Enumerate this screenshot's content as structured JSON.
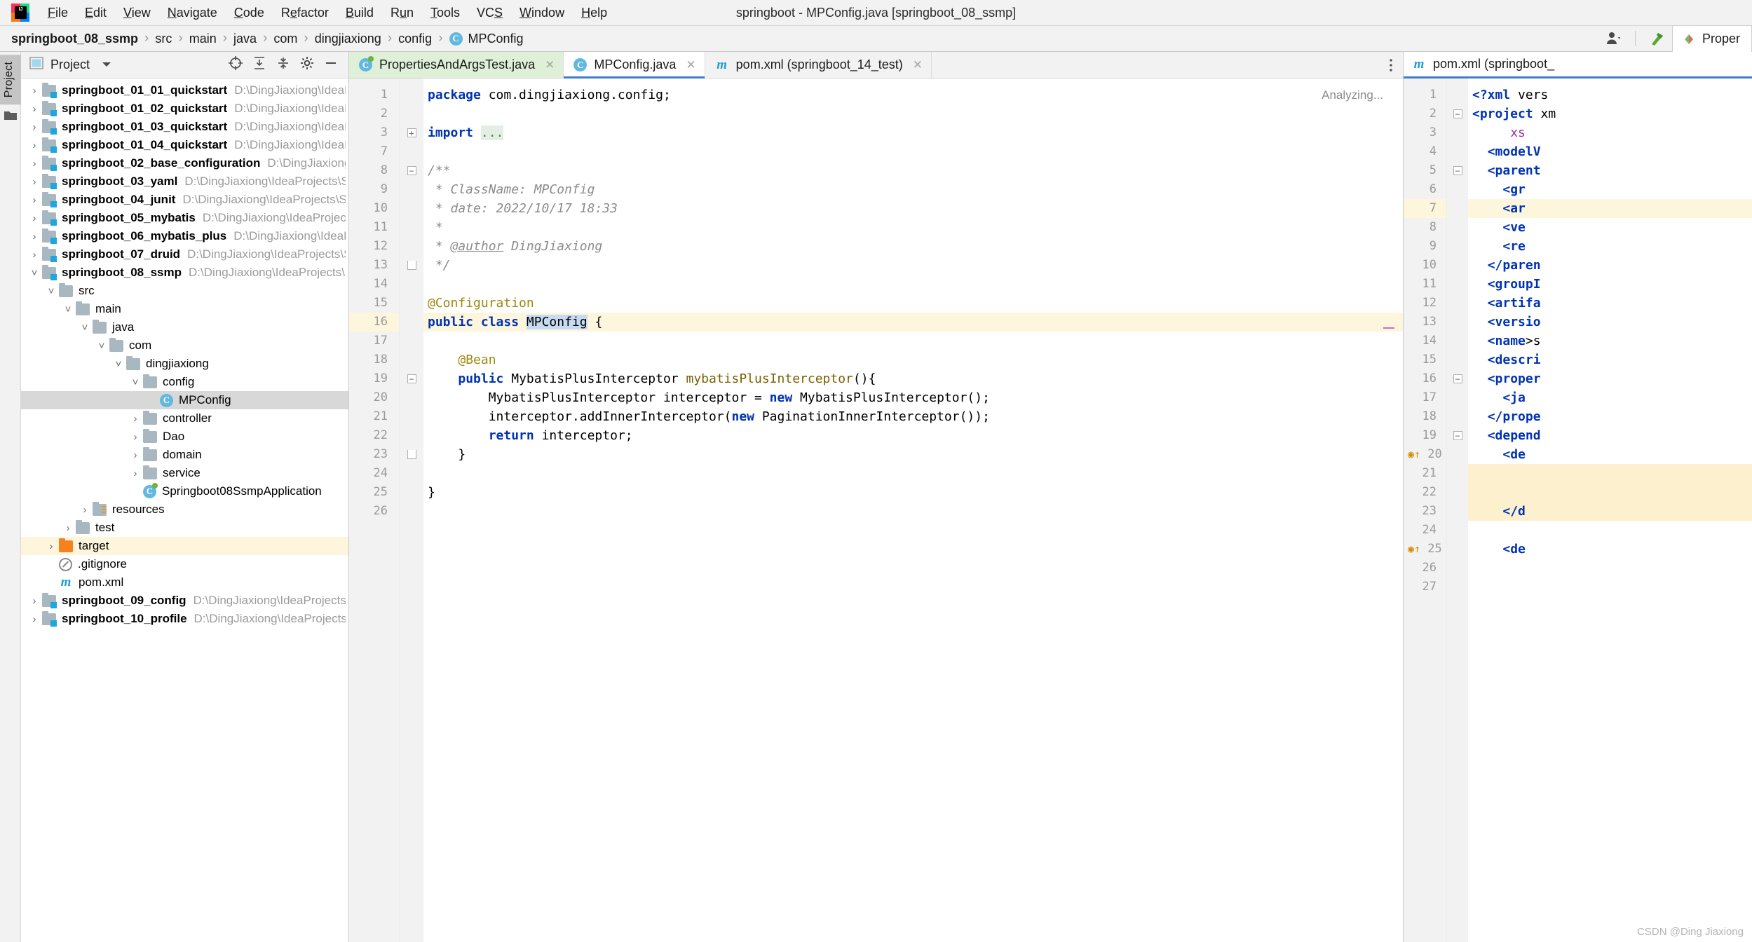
{
  "window": {
    "title": "springboot - MPConfig.java [springboot_08_ssmp]",
    "logo_text": "IJ"
  },
  "menubar": {
    "items": [
      {
        "label": "File",
        "mnemonic": "F"
      },
      {
        "label": "Edit",
        "mnemonic": "E"
      },
      {
        "label": "View",
        "mnemonic": "V"
      },
      {
        "label": "Navigate",
        "mnemonic": "N"
      },
      {
        "label": "Code",
        "mnemonic": "C"
      },
      {
        "label": "Refactor",
        "mnemonic": "e"
      },
      {
        "label": "Build",
        "mnemonic": "B"
      },
      {
        "label": "Run",
        "mnemonic": "u"
      },
      {
        "label": "Tools",
        "mnemonic": "T"
      },
      {
        "label": "VCS",
        "mnemonic": "S"
      },
      {
        "label": "Window",
        "mnemonic": "W"
      },
      {
        "label": "Help",
        "mnemonic": "H"
      }
    ]
  },
  "navbar": {
    "crumbs": [
      {
        "label": "springboot_08_ssmp",
        "bold": true,
        "icon": ""
      },
      {
        "label": "src",
        "bold": false,
        "icon": ""
      },
      {
        "label": "main",
        "bold": false,
        "icon": ""
      },
      {
        "label": "java",
        "bold": false,
        "icon": ""
      },
      {
        "label": "com",
        "bold": false,
        "icon": ""
      },
      {
        "label": "dingjiaxiong",
        "bold": false,
        "icon": ""
      },
      {
        "label": "config",
        "bold": false,
        "icon": ""
      },
      {
        "label": "MPConfig",
        "bold": false,
        "icon": "class-icon",
        "icon_letter": "C"
      }
    ],
    "separator": "›",
    "properties_tab_label": "Proper"
  },
  "tool_strip": {
    "project_tab_label": "Project"
  },
  "project_panel": {
    "header_title": "Project",
    "tree": [
      {
        "depth": 0,
        "arrow": "›",
        "icon": "module-folder-icon",
        "label": "springboot_01_01_quickstart",
        "path": "D:\\DingJiaxiong\\IdeaProje",
        "bold": true
      },
      {
        "depth": 0,
        "arrow": "›",
        "icon": "module-folder-icon",
        "label": "springboot_01_02_quickstart",
        "path": "D:\\DingJiaxiong\\IdeaProje",
        "bold": true
      },
      {
        "depth": 0,
        "arrow": "›",
        "icon": "module-folder-icon",
        "label": "springboot_01_03_quickstart",
        "path": "D:\\DingJiaxiong\\IdeaProje",
        "bold": true
      },
      {
        "depth": 0,
        "arrow": "›",
        "icon": "module-folder-icon",
        "label": "springboot_01_04_quickstart",
        "path": "D:\\DingJiaxiong\\IdeaProje",
        "bold": true
      },
      {
        "depth": 0,
        "arrow": "›",
        "icon": "module-folder-icon",
        "label": "springboot_02_base_configuration",
        "path": "D:\\DingJiaxiong\\Idea",
        "bold": true
      },
      {
        "depth": 0,
        "arrow": "›",
        "icon": "module-folder-icon",
        "label": "springboot_03_yaml",
        "path": "D:\\DingJiaxiong\\IdeaProjects\\Spring",
        "bold": true
      },
      {
        "depth": 0,
        "arrow": "›",
        "icon": "module-folder-icon",
        "label": "springboot_04_junit",
        "path": "D:\\DingJiaxiong\\IdeaProjects\\Sprin",
        "bold": true
      },
      {
        "depth": 0,
        "arrow": "›",
        "icon": "module-folder-icon",
        "label": "springboot_05_mybatis",
        "path": "D:\\DingJiaxiong\\IdeaProjects\\Sp",
        "bold": true
      },
      {
        "depth": 0,
        "arrow": "›",
        "icon": "module-folder-icon",
        "label": "springboot_06_mybatis_plus",
        "path": "D:\\DingJiaxiong\\IdeaProje",
        "bold": true
      },
      {
        "depth": 0,
        "arrow": "›",
        "icon": "module-folder-icon",
        "label": "springboot_07_druid",
        "path": "D:\\DingJiaxiong\\IdeaProjects\\Sprin",
        "bold": true
      },
      {
        "depth": 0,
        "arrow": "˅",
        "icon": "module-folder-icon",
        "label": "springboot_08_ssmp",
        "path": "D:\\DingJiaxiong\\IdeaProjects\\Sprin",
        "bold": true
      },
      {
        "depth": 1,
        "arrow": "˅",
        "icon": "folder-icon",
        "label": "src",
        "path": "",
        "bold": false
      },
      {
        "depth": 2,
        "arrow": "˅",
        "icon": "folder-icon",
        "label": "main",
        "path": "",
        "bold": false
      },
      {
        "depth": 3,
        "arrow": "˅",
        "icon": "folder-icon",
        "label": "java",
        "path": "",
        "bold": false
      },
      {
        "depth": 4,
        "arrow": "˅",
        "icon": "folder-icon",
        "label": "com",
        "path": "",
        "bold": false
      },
      {
        "depth": 5,
        "arrow": "˅",
        "icon": "folder-icon",
        "label": "dingjiaxiong",
        "path": "",
        "bold": false
      },
      {
        "depth": 6,
        "arrow": "˅",
        "icon": "folder-icon",
        "label": "config",
        "path": "",
        "bold": false
      },
      {
        "depth": 7,
        "arrow": "",
        "icon": "class-icon",
        "label": "MPConfig",
        "path": "",
        "bold": false,
        "selected": true
      },
      {
        "depth": 6,
        "arrow": "›",
        "icon": "folder-icon",
        "label": "controller",
        "path": "",
        "bold": false
      },
      {
        "depth": 6,
        "arrow": "›",
        "icon": "folder-icon",
        "label": "Dao",
        "path": "",
        "bold": false
      },
      {
        "depth": 6,
        "arrow": "›",
        "icon": "folder-icon",
        "label": "domain",
        "path": "",
        "bold": false
      },
      {
        "depth": 6,
        "arrow": "›",
        "icon": "folder-icon",
        "label": "service",
        "path": "",
        "bold": false
      },
      {
        "depth": 6,
        "arrow": "",
        "icon": "spring-class-icon",
        "label": "Springboot08SsmpApplication",
        "path": "",
        "bold": false
      },
      {
        "depth": 3,
        "arrow": "›",
        "icon": "resources-folder-icon",
        "label": "resources",
        "path": "",
        "bold": false
      },
      {
        "depth": 2,
        "arrow": "›",
        "icon": "folder-icon",
        "label": "test",
        "path": "",
        "bold": false
      },
      {
        "depth": 1,
        "arrow": "›",
        "icon": "target-folder-icon",
        "label": "target",
        "path": "",
        "bold": false,
        "highlight": true
      },
      {
        "depth": 1,
        "arrow": "",
        "icon": "gitignore-icon",
        "label": ".gitignore",
        "path": "",
        "bold": false
      },
      {
        "depth": 1,
        "arrow": "",
        "icon": "maven-icon",
        "label": "pom.xml",
        "path": "",
        "bold": false
      },
      {
        "depth": 0,
        "arrow": "›",
        "icon": "module-folder-icon",
        "label": "springboot_09_config",
        "path": "D:\\DingJiaxiong\\IdeaProjects\\Spri",
        "bold": true
      },
      {
        "depth": 0,
        "arrow": "›",
        "icon": "module-folder-icon",
        "label": "springboot_10_profile",
        "path": "D:\\DingJiaxiong\\IdeaProjects\\Sp",
        "bold": true
      }
    ]
  },
  "editor": {
    "tabs": [
      {
        "label": "PropertiesAndArgsTest.java",
        "icon": "test-class-icon",
        "state": "modified",
        "closable": true
      },
      {
        "label": "MPConfig.java",
        "icon": "class-icon",
        "state": "active",
        "closable": true
      },
      {
        "label": "pom.xml (springboot_14_test)",
        "icon": "maven-icon",
        "state": "normal",
        "closable": true
      }
    ],
    "status_text": "Analyzing...",
    "lines": [
      {
        "num": "1",
        "fold": "",
        "text": "package com.dingjiaxiong.config;"
      },
      {
        "num": "2",
        "fold": "",
        "text": ""
      },
      {
        "num": "3",
        "fold": "plus",
        "text": "import ..."
      },
      {
        "num": "7",
        "fold": "",
        "text": ""
      },
      {
        "num": "8",
        "fold": "minus",
        "text": "/**"
      },
      {
        "num": "9",
        "fold": "",
        "text": " * ClassName: MPConfig"
      },
      {
        "num": "10",
        "fold": "",
        "text": " * date: 2022/10/17 18:33"
      },
      {
        "num": "11",
        "fold": "",
        "text": " *"
      },
      {
        "num": "12",
        "fold": "",
        "text": " * @author DingJiaxiong"
      },
      {
        "num": "13",
        "fold": "brace",
        "text": " */"
      },
      {
        "num": "14",
        "fold": "",
        "text": ""
      },
      {
        "num": "15",
        "fold": "",
        "text": "@Configuration"
      },
      {
        "num": "16",
        "fold": "",
        "text": "public class MPConfig {",
        "highlight": true
      },
      {
        "num": "17",
        "fold": "",
        "text": ""
      },
      {
        "num": "18",
        "fold": "",
        "text": "    @Bean"
      },
      {
        "num": "19",
        "fold": "minus",
        "text": "    public MybatisPlusInterceptor mybatisPlusInterceptor(){"
      },
      {
        "num": "20",
        "fold": "",
        "text": "        MybatisPlusInterceptor interceptor = new MybatisPlusInterceptor();"
      },
      {
        "num": "21",
        "fold": "",
        "text": "        interceptor.addInnerInterceptor(new PaginationInnerInterceptor());"
      },
      {
        "num": "22",
        "fold": "",
        "text": "        return interceptor;"
      },
      {
        "num": "23",
        "fold": "brace",
        "text": "    }"
      },
      {
        "num": "24",
        "fold": "",
        "text": ""
      },
      {
        "num": "25",
        "fold": "",
        "text": "}"
      },
      {
        "num": "26",
        "fold": "",
        "text": ""
      }
    ]
  },
  "right_panel": {
    "tab_label": "pom.xml (springboot_",
    "watermark": "CSDN @Ding Jiaxiong",
    "lines": [
      {
        "num": "1",
        "fold": "",
        "text": "<?xml vers"
      },
      {
        "num": "2",
        "fold": "minus",
        "text": "<project xm"
      },
      {
        "num": "3",
        "fold": "",
        "text": "     xs"
      },
      {
        "num": "4",
        "fold": "",
        "text": "  <modelV"
      },
      {
        "num": "5",
        "fold": "minus",
        "text": "  <parent"
      },
      {
        "num": "6",
        "fold": "",
        "text": "    <gr"
      },
      {
        "num": "7",
        "fold": "",
        "text": "    <ar",
        "highlight": true
      },
      {
        "num": "8",
        "fold": "",
        "text": "    <ve"
      },
      {
        "num": "9",
        "fold": "",
        "text": "    <re"
      },
      {
        "num": "10",
        "fold": "",
        "text": "  </paren"
      },
      {
        "num": "11",
        "fold": "",
        "text": "  <groupI"
      },
      {
        "num": "12",
        "fold": "",
        "text": "  <artifa"
      },
      {
        "num": "13",
        "fold": "",
        "text": "  <versio"
      },
      {
        "num": "14",
        "fold": "",
        "text": "  <name>s"
      },
      {
        "num": "15",
        "fold": "",
        "text": "  <descri"
      },
      {
        "num": "16",
        "fold": "minus",
        "text": "  <proper"
      },
      {
        "num": "17",
        "fold": "",
        "text": "    <ja"
      },
      {
        "num": "18",
        "fold": "",
        "text": "  </prope"
      },
      {
        "num": "19",
        "fold": "minus",
        "text": "  <depend"
      },
      {
        "num": "20",
        "fold": "",
        "text": "    <de",
        "gutter_mark": true
      },
      {
        "num": "21",
        "fold": "",
        "text": "",
        "band": true
      },
      {
        "num": "22",
        "fold": "",
        "text": "",
        "band": true
      },
      {
        "num": "23",
        "fold": "",
        "text": "    </d",
        "band": true
      },
      {
        "num": "24",
        "fold": "",
        "text": ""
      },
      {
        "num": "25",
        "fold": "",
        "text": "    <de",
        "gutter_mark": true
      },
      {
        "num": "26",
        "fold": "",
        "text": ""
      },
      {
        "num": "27",
        "fold": "",
        "text": ""
      }
    ]
  },
  "colors": {
    "accent": "#3d7ecb",
    "keyword": "#0033b3",
    "comment": "#8c8c8c",
    "annotation": "#9e880d",
    "selection": "#c6dbf1",
    "highlight_line": "#fdf6dd",
    "folder": "#a9b7c0",
    "module_badge": "#1fa6dd",
    "target_folder": "#f6821f"
  }
}
